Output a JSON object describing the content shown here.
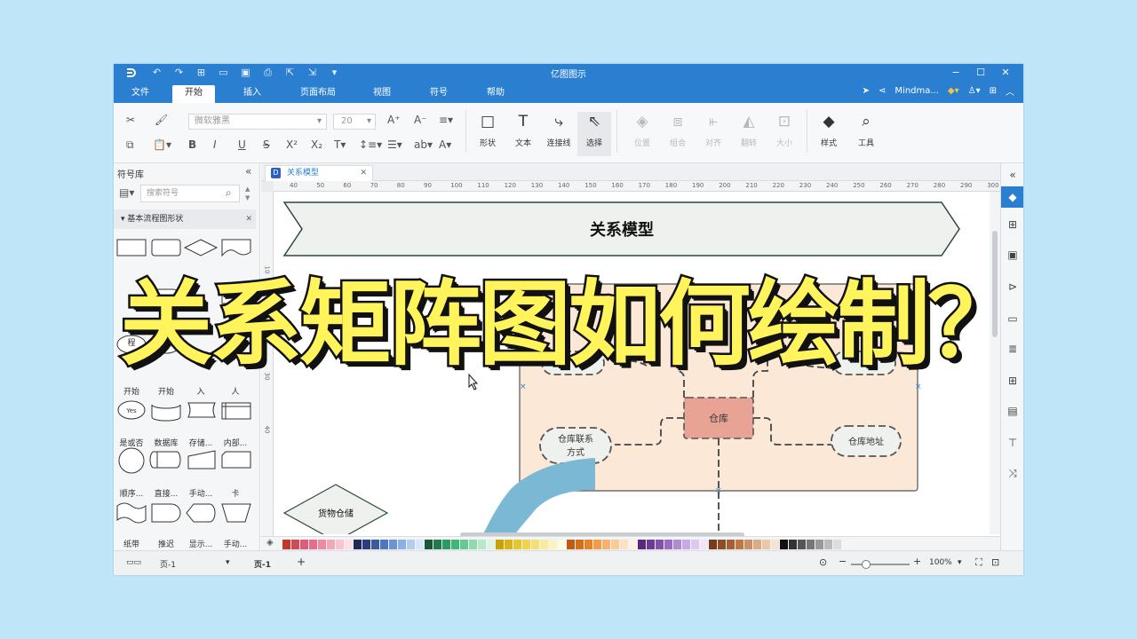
{
  "window": {
    "title": "亿图图示",
    "controls": [
      "minimize-icon",
      "maximize-icon",
      "close-icon"
    ]
  },
  "menu": {
    "tabs": [
      "文件",
      "开始",
      "插入",
      "页面布局",
      "视图",
      "符号",
      "帮助"
    ],
    "active": "开始",
    "user": "Mindma..."
  },
  "ribbon": {
    "font_name": "微软雅黑",
    "font_size": "20",
    "tools": [
      "形状",
      "文本",
      "连接线",
      "选择"
    ],
    "arrange": [
      "位置",
      "组合",
      "对齐",
      "翻转",
      "大小"
    ],
    "style_label": "样式",
    "tools_label": "工具"
  },
  "library": {
    "title": "符号库",
    "search_placeholder": "搜索符号",
    "category": "基本流程图形状",
    "shape_labels": {
      "row1": [
        "程",
        "流程",
        "",
        ""
      ],
      "row2": [
        "开始",
        "开始",
        "入",
        "人"
      ],
      "row3": [
        "是或否",
        "数据库",
        "存储...",
        "内部..."
      ],
      "row4": [
        "顺序...",
        "直接...",
        "手动...",
        "卡"
      ],
      "row5": [
        "纸带",
        "推迟",
        "显示...",
        "手动..."
      ]
    },
    "yes_shape_text": "Yes"
  },
  "document": {
    "tab_title": "关系模型"
  },
  "ruler": {
    "h": [
      "40",
      "50",
      "60",
      "70",
      "80",
      "90",
      "100",
      "110",
      "120",
      "130",
      "140",
      "150",
      "160",
      "170",
      "180",
      "190",
      "200",
      "210",
      "220",
      "230",
      "240",
      "250",
      "260",
      "270",
      "280",
      "290",
      "300"
    ],
    "v": [
      "10",
      "20",
      "30",
      "40"
    ]
  },
  "diagram": {
    "banner": "关系模型",
    "center": "仓库",
    "left": "仓库联系\n方式",
    "right": "仓库地址",
    "diamond": "货物仓储"
  },
  "status": {
    "page_selector": "页-1",
    "page_tab": "页-1",
    "add": "+",
    "zoom": "100%"
  },
  "overlay_title": "关系矩阵图如何绘制？",
  "colors": {
    "accent": "#2a7fd1",
    "overlay_text": "#fff45c",
    "center_node": "#e8a394",
    "container": "#fbe8d6"
  }
}
